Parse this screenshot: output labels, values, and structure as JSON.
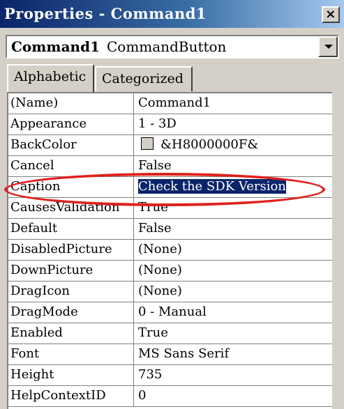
{
  "window": {
    "title": "Properties - Command1",
    "close_glyph": "×"
  },
  "object_selector": {
    "name": "Command1",
    "type": "CommandButton"
  },
  "tabs": [
    {
      "label": "Alphabetic",
      "active": true
    },
    {
      "label": "Categorized",
      "active": false
    }
  ],
  "properties": [
    {
      "name": "(Name)",
      "value": "Command1"
    },
    {
      "name": "Appearance",
      "value": "1 - 3D"
    },
    {
      "name": "BackColor",
      "value": "&H8000000F&",
      "swatch": "#d4d0c8"
    },
    {
      "name": "Cancel",
      "value": "False"
    },
    {
      "name": "Caption",
      "value": "Check the SDK Version",
      "selected": true
    },
    {
      "name": "CausesValidation",
      "value": "True"
    },
    {
      "name": "Default",
      "value": "False"
    },
    {
      "name": "DisabledPicture",
      "value": "(None)"
    },
    {
      "name": "DownPicture",
      "value": "(None)"
    },
    {
      "name": "DragIcon",
      "value": "(None)"
    },
    {
      "name": "DragMode",
      "value": "0 - Manual"
    },
    {
      "name": "Enabled",
      "value": "True"
    },
    {
      "name": "Font",
      "value": "MS Sans Serif"
    },
    {
      "name": "Height",
      "value": "735"
    },
    {
      "name": "HelpContextID",
      "value": "0"
    }
  ],
  "colors": {
    "title_bar": "#0a246a",
    "selection": "#0a246a",
    "annotation": "#e0201c"
  }
}
